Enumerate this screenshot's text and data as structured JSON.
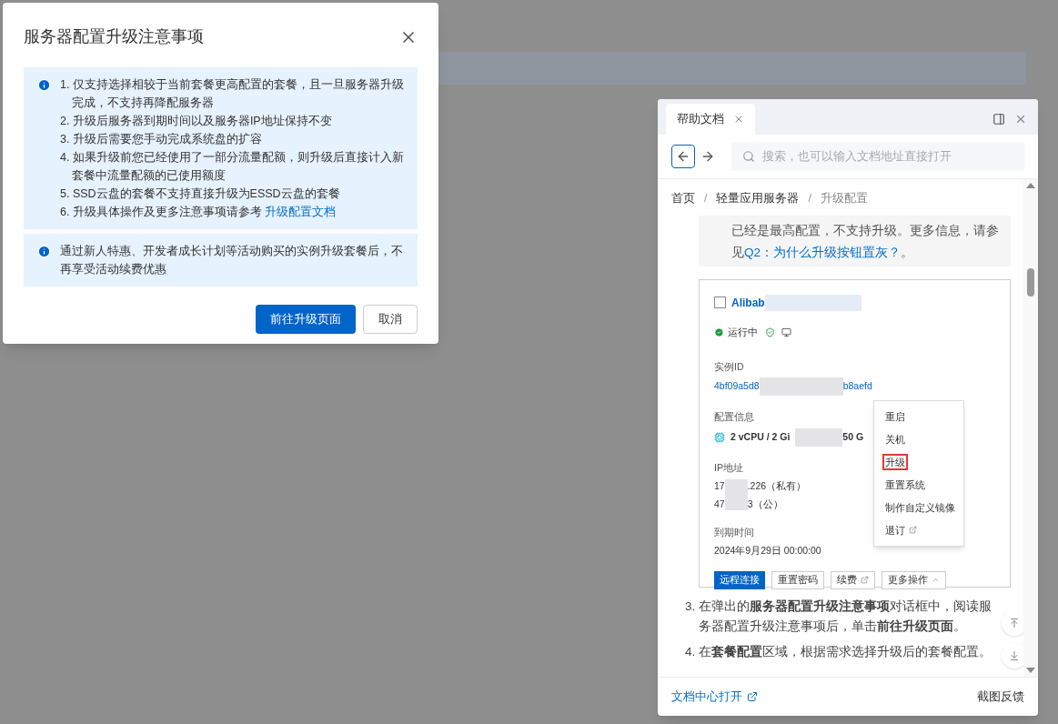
{
  "dialog": {
    "title": "服务器配置升级注意事项",
    "notices": [
      {
        "items": [
          "1. 仅支持选择相较于当前套餐更高配置的套餐，且一旦服务器升级完成，不支持再降配服务器",
          "2. 升级后服务器到期时间以及服务器IP地址保持不变",
          "3. 升级后需要您手动完成系统盘的扩容",
          "4. 如果升级前您已经使用了一部分流量配额，则升级后直接计入新套餐中流量配额的已使用额度",
          "5. SSD云盘的套餐不支持直接升级为ESSD云盘的套餐",
          "6. 升级具体操作及更多注意事项请参考"
        ],
        "link": "升级配置文档"
      },
      {
        "items": [
          "通过新人特惠、开发者成长计划等活动购买的实例升级套餐后，不再享受活动续费优惠"
        ]
      }
    ],
    "buttons": [
      {
        "label": "前往升级页面",
        "kind": "primary"
      },
      {
        "label": "取消",
        "kind": "secondary"
      }
    ]
  },
  "help_panel": {
    "tab": {
      "label": "帮助文档",
      "selected": true
    },
    "search": {
      "placeholder": "搜索，也可以输入文档地址直接打开"
    },
    "breadcrumb": [
      "首页",
      "轻量应用服务器",
      "升级配置"
    ],
    "breadcrumb_separator": "/",
    "note": {
      "text": "已经是最高配置，不支持升级。更多信息，请参见",
      "link": "Q2：为什么升级按钮置灰？",
      "end": "。"
    },
    "screenshot": {
      "name": "Alibab",
      "checked": false,
      "status": "运行中",
      "fields": [
        {
          "label": "实例ID",
          "value": "4bf09a5d8",
          "value_end": "b8aefd",
          "kind": "link"
        },
        {
          "label": "配置信息",
          "value": "2 vCPU / 2 Gi",
          "value_end": "50 G",
          "kind": "spec"
        },
        {
          "label": "IP地址",
          "value": "17",
          "value_end": ".226（私有）",
          "value2": "47",
          "value2_end": "3（公）",
          "kind": "ip"
        },
        {
          "label": "到期时间",
          "value": "2024年9月29日 00:00:00",
          "kind": "plain"
        }
      ],
      "menu": [
        {
          "label": "重启",
          "highlighted": false,
          "external": false
        },
        {
          "label": "关机",
          "highlighted": false,
          "external": false
        },
        {
          "label": "升级",
          "highlighted": true,
          "external": false
        },
        {
          "label": "重置系统",
          "highlighted": false,
          "external": false
        },
        {
          "label": "制作自定义镜像",
          "highlighted": false,
          "external": false
        },
        {
          "label": "退订",
          "highlighted": false,
          "external": true
        }
      ],
      "actions": [
        {
          "label": "远程连接",
          "kind": "primary"
        },
        {
          "label": "重置密码",
          "kind": "plain"
        },
        {
          "label": "续费",
          "kind": "external"
        },
        {
          "label": "更多操作",
          "kind": "dropdown"
        }
      ]
    },
    "steps": [
      "3. ",
      "在弹出的**服务器配置升级注意事项**对话框中，阅读服务器配置升级注意事项后，单击**前往升级页面**。",
      "4. ",
      "在**套餐配置**区域，根据需求选择升级后的套餐配置。"
    ],
    "footer": {
      "open_link": "文档中心打开",
      "feedback": "截图反馈"
    }
  }
}
